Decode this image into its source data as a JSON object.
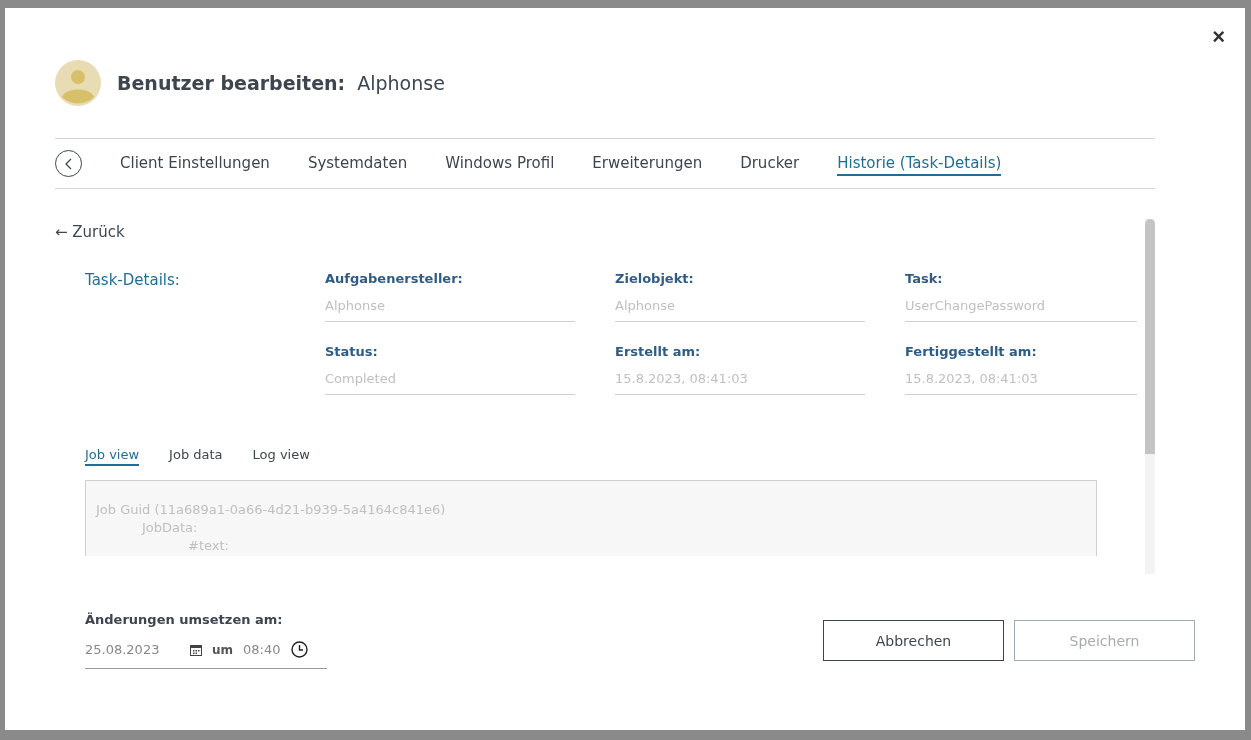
{
  "dialog": {
    "title": "Benutzer bearbeiten:",
    "user_name": "Alphonse",
    "close": "×"
  },
  "tabs": [
    {
      "label": "Client Einstellungen",
      "selected": false
    },
    {
      "label": "Systemdaten",
      "selected": false
    },
    {
      "label": "Windows Profil",
      "selected": false
    },
    {
      "label": "Erweiterungen",
      "selected": false
    },
    {
      "label": "Drucker",
      "selected": false
    },
    {
      "label": "Historie (Task-Details)",
      "selected": true
    }
  ],
  "back_link": "← Zurück",
  "task_details": {
    "heading": "Task-Details:",
    "fields": [
      {
        "label": "Aufgabenersteller:",
        "value": "Alphonse"
      },
      {
        "label": "Zielobjekt:",
        "value": "Alphonse"
      },
      {
        "label": "Task:",
        "value": "UserChangePassword"
      },
      {
        "label": "Status:",
        "value": "Completed"
      },
      {
        "label": "Erstellt am:",
        "value": "15.8.2023, 08:41:03"
      },
      {
        "label": "Fertiggestellt am:",
        "value": "15.8.2023, 08:41:03"
      }
    ]
  },
  "view_tabs": [
    {
      "label": "Job view",
      "selected": true
    },
    {
      "label": "Job data",
      "selected": false
    },
    {
      "label": "Log view",
      "selected": false
    }
  ],
  "job_view_lines": [
    "Job Guid (11a689a1-0a66-4d21-b939-5a4164c841e6)",
    "JobData:",
    "#text:"
  ],
  "schedule": {
    "label": "Änderungen umsetzen am:",
    "date": "25.08.2023",
    "separator": "um",
    "time": "08:40"
  },
  "buttons": [
    {
      "label": "Abbrechen",
      "disabled": false
    },
    {
      "label": "Speichern",
      "disabled": true
    }
  ]
}
